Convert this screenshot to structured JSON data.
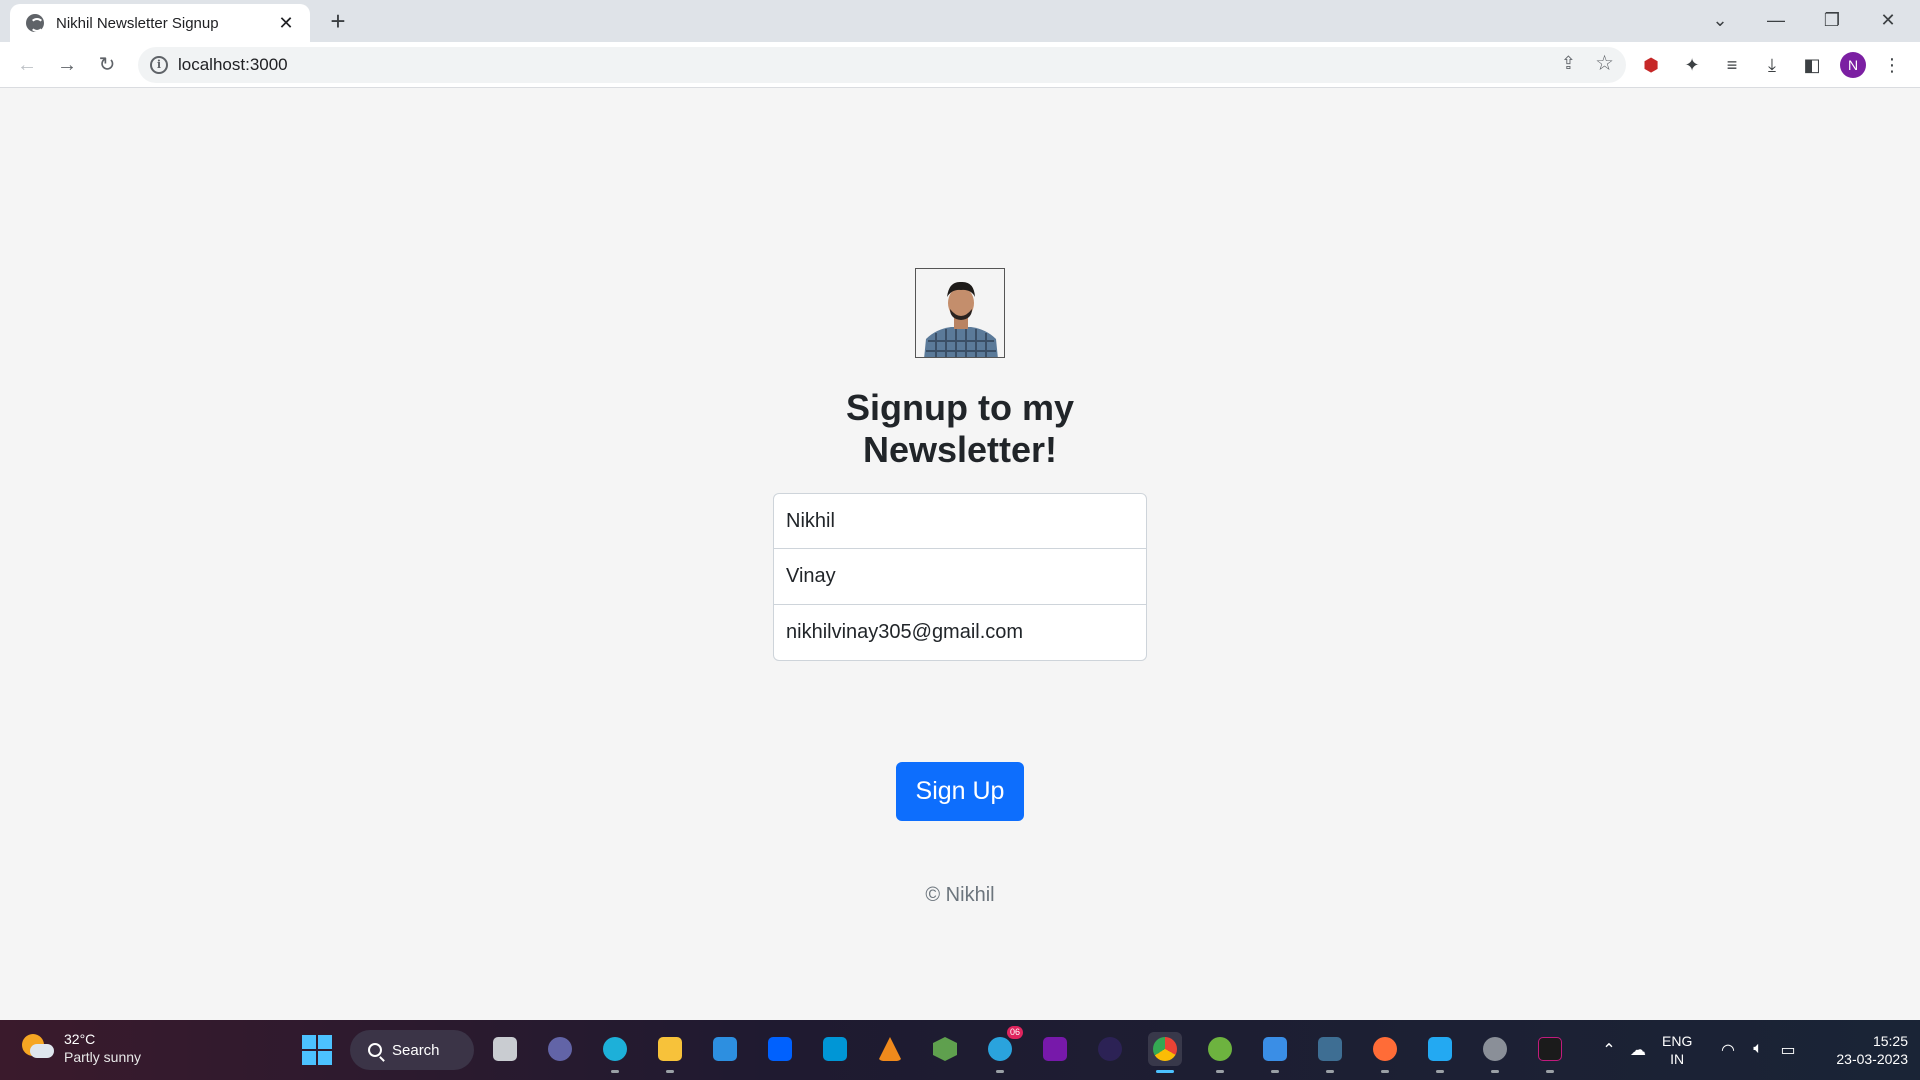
{
  "browser": {
    "tab_title": "Nikhil Newsletter Signup",
    "tab_close": "✕",
    "new_tab": "+",
    "url": "localhost:3000",
    "profile_initial": "N"
  },
  "page": {
    "heading_line1": "Signup to my",
    "heading_line2": "Newsletter!",
    "first_name_value": "Nikhil",
    "last_name_value": "Vinay",
    "email_value": "nikhilvinay305@gmail.com",
    "signup_label": "Sign Up",
    "footer_text": "© Nikhil",
    "button_color": "#0d6efd"
  },
  "taskbar": {
    "weather_temp": "32°C",
    "weather_condition": "Partly sunny",
    "search_label": "Search",
    "telegram_badge": "06",
    "lang_line1": "ENG",
    "lang_line2": "IN",
    "time": "15:25",
    "date": "23-03-2023"
  }
}
